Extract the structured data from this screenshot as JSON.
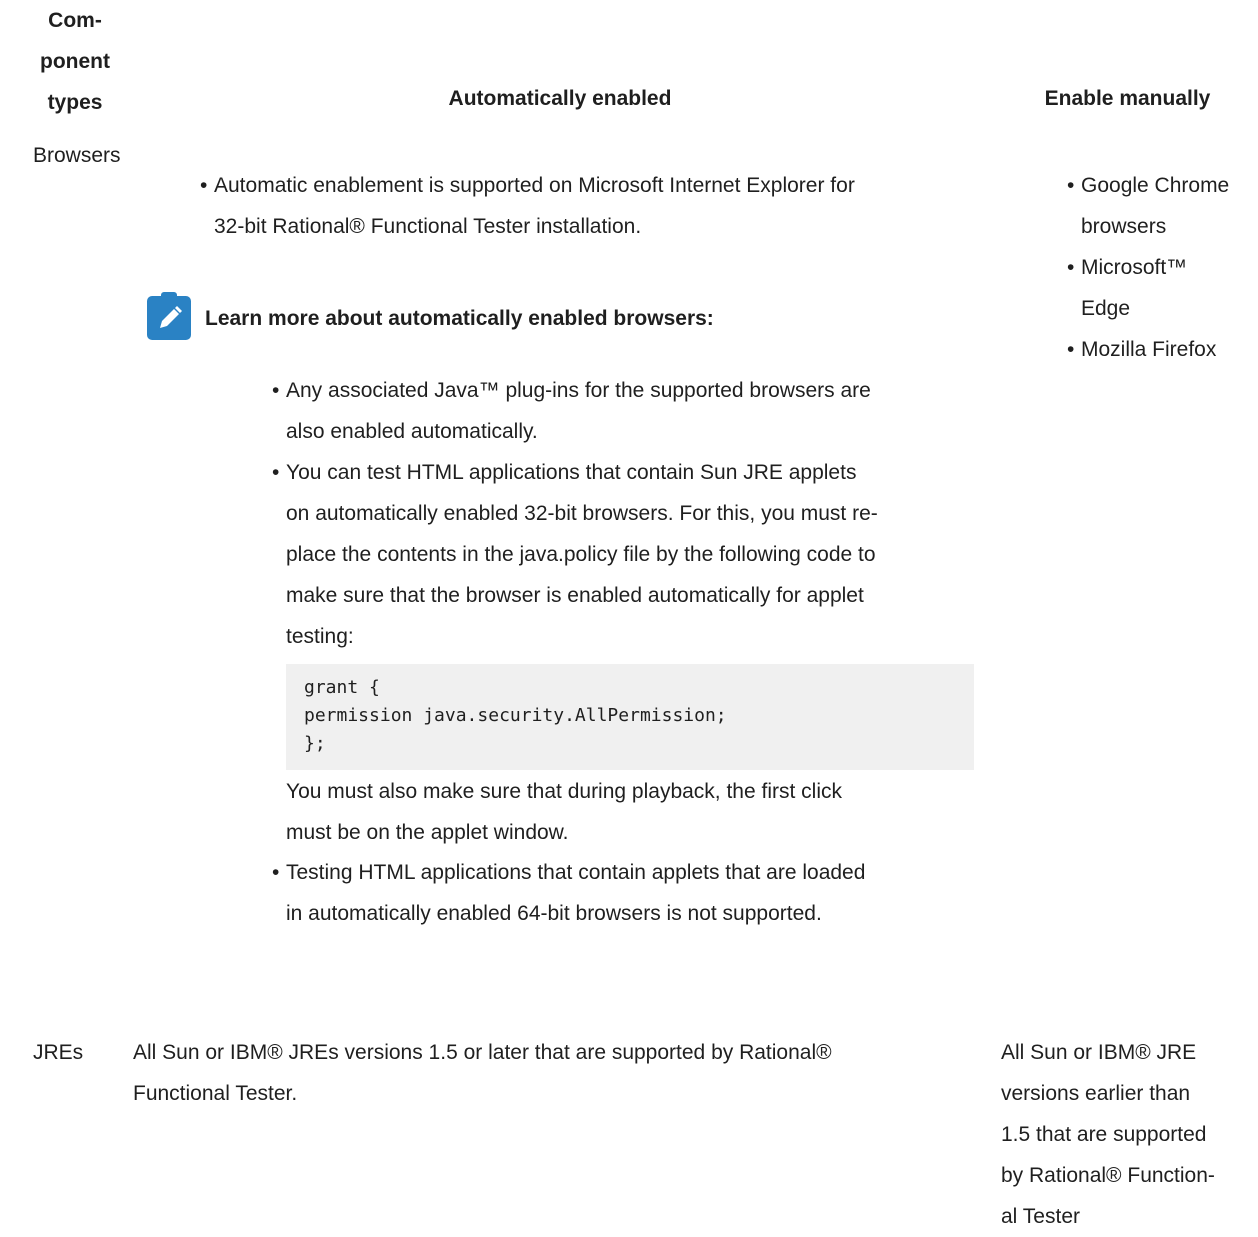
{
  "table": {
    "headers": {
      "component_types": [
        "Com-",
        "ponent",
        "types"
      ],
      "auto": "Automatically enabled",
      "manual": "Enable manually"
    },
    "rows": {
      "browsers": {
        "type": "Browsers",
        "auto_bullet": [
          "Automatic enablement is supported on Microsoft Internet Explorer for",
          "32-bit Rational® Functional Tester installation."
        ],
        "note_title": "Learn more about automatically enabled browsers:",
        "note_items": [
          [
            "Any associated Java™ plug-ins for the supported browsers are",
            "also enabled automatically."
          ],
          [
            "You can test HTML applications that contain Sun JRE applets",
            "on automatically enabled 32-bit browsers. For this, you must re-",
            "place the contents in the java.policy file by the following code to",
            "make sure that the browser is enabled automatically for applet",
            "testing:"
          ]
        ],
        "code": "grant {\npermission java.security.AllPermission;\n};",
        "after_code": [
          "You must also make sure that during playback, the first click",
          "must be on the applet window."
        ],
        "note_last_item": [
          "Testing HTML applications that contain applets that are loaded",
          "in automatically enabled 64-bit browsers is not supported."
        ],
        "manual_items": [
          [
            "Google Chrome",
            "browsers"
          ],
          [
            "Microsoft™",
            "Edge"
          ],
          [
            "Mozilla Firefox"
          ]
        ]
      },
      "jres": {
        "type": "JREs",
        "auto": [
          "All Sun or IBM® JREs versions 1.5 or later that are supported by Rational®",
          "Functional Tester."
        ],
        "manual": [
          "All Sun or IBM® JRE",
          "versions earlier than",
          "1.5 that are supported",
          "by Rational® Function-",
          "al Tester"
        ]
      }
    }
  },
  "colors": {
    "note_icon": "#2a82c4",
    "code_bg": "#f0f0f0"
  },
  "icons": {
    "note": "pencil-note-icon"
  }
}
